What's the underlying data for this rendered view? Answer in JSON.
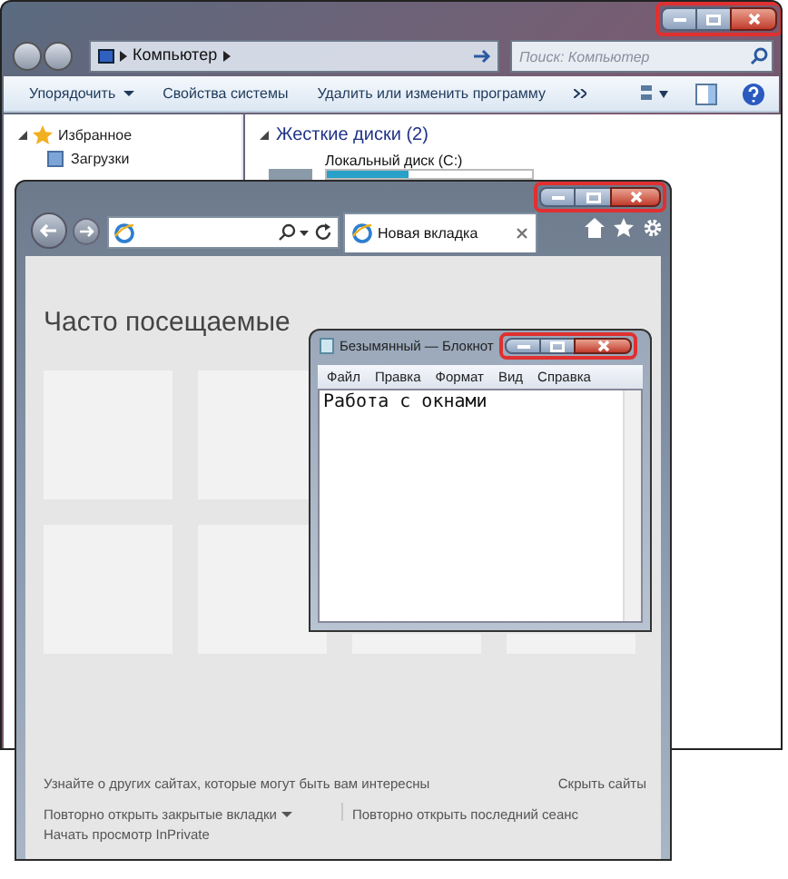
{
  "explorer": {
    "caption_buttons_highlighted": true,
    "address": {
      "path": "Компьютер",
      "search_placeholder": "Поиск: Компьютер"
    },
    "toolbar": [
      {
        "label": "Упорядочить",
        "kind": "dropdown"
      },
      {
        "label": "Свойства системы",
        "kind": "plain"
      },
      {
        "label": "Удалить или изменить программу",
        "kind": "plain"
      }
    ],
    "sidebar": [
      {
        "label": "Избранное",
        "expanded": true,
        "children": [
          {
            "label": "Загрузки"
          }
        ]
      }
    ],
    "section": "Жесткие диски (2)",
    "drive": {
      "name": "Локальный диск (C:)",
      "level": 0.4
    }
  },
  "browser": {
    "caption_buttons_highlighted": true,
    "tab": {
      "label": "Новая вкладка",
      "selected": true
    },
    "heading": "Часто посещаемые",
    "discover": "Узнайте о других сайтах, которые могут быть вам интересны",
    "hide": "Скрыть сайты",
    "reopen_tabs": "Повторно открыть закрытые вкладки",
    "reopen_session": "Повторно открыть последний сеанс",
    "inprivate": "Начать просмотр InPrivate"
  },
  "notepad": {
    "caption_buttons_highlighted": true,
    "title": "Безымянный — Блокнот",
    "menu": [
      "Файл",
      "Правка",
      "Формат",
      "Вид",
      "Справка"
    ],
    "text": "Работа с окнами"
  }
}
